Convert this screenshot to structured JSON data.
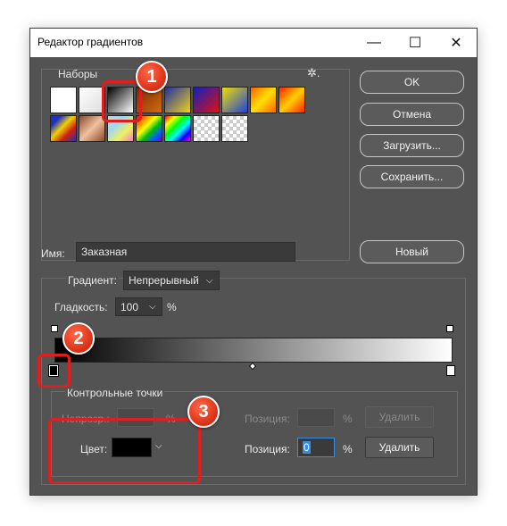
{
  "window": {
    "title": "Редактор градиентов",
    "minimize": "—",
    "maximize": "☐",
    "close": "✕"
  },
  "presets": {
    "label": "Наборы",
    "gear": "✲."
  },
  "buttons": {
    "ok": "OK",
    "cancel": "Отмена",
    "load": "Загрузить...",
    "save": "Сохранить...",
    "new": "Новый",
    "delete": "Удалить"
  },
  "name": {
    "label": "Имя:",
    "value": "Заказная"
  },
  "gradient_type": {
    "label": "Градиент:",
    "value": "Непрерывный"
  },
  "smoothness": {
    "label": "Гладкость:",
    "value": "100",
    "unit": "%"
  },
  "stops": {
    "label": "Контрольные точки",
    "opacity_label": "Непрозр.:",
    "opacity_unit": "%",
    "position_label": "Позиция:",
    "position_unit": "%",
    "position_value": "0",
    "color_label": "Цвет:"
  },
  "callouts": [
    "1",
    "2",
    "3"
  ],
  "colors": {
    "dialog_bg": "#535353",
    "accent_red": "#e11d1d",
    "field_focus": "#3b8de0"
  }
}
